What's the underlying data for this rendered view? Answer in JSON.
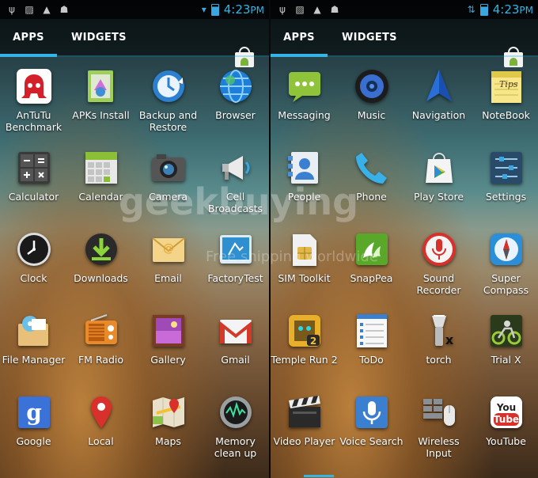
{
  "status": {
    "time": "4:23",
    "ampm": "PM"
  },
  "tabs": {
    "apps": "APPS",
    "widgets": "WIDGETS"
  },
  "watermark": {
    "main": "geekbuying",
    "sub": "Free shipping worldwide"
  },
  "colors": {
    "accent": "#33b5e5"
  },
  "left_apps": [
    {
      "label": "AnTuTu Benchmark",
      "icon": "antutu-icon"
    },
    {
      "label": "APKs Install",
      "icon": "apk-install-icon"
    },
    {
      "label": "Backup and Restore",
      "icon": "backup-restore-icon"
    },
    {
      "label": "Browser",
      "icon": "browser-globe-icon"
    },
    {
      "label": "Calculator",
      "icon": "calculator-icon"
    },
    {
      "label": "Calendar",
      "icon": "calendar-icon"
    },
    {
      "label": "Camera",
      "icon": "camera-icon"
    },
    {
      "label": "Cell Broadcasts",
      "icon": "megaphone-icon"
    },
    {
      "label": "Clock",
      "icon": "clock-icon"
    },
    {
      "label": "Downloads",
      "icon": "download-icon"
    },
    {
      "label": "Email",
      "icon": "email-icon"
    },
    {
      "label": "FactoryTest",
      "icon": "factory-test-icon"
    },
    {
      "label": "File Manager",
      "icon": "file-manager-icon"
    },
    {
      "label": "FM Radio",
      "icon": "radio-icon"
    },
    {
      "label": "Gallery",
      "icon": "gallery-icon"
    },
    {
      "label": "Gmail",
      "icon": "gmail-icon"
    },
    {
      "label": "Google",
      "icon": "google-icon"
    },
    {
      "label": "Local",
      "icon": "map-pin-icon"
    },
    {
      "label": "Maps",
      "icon": "maps-icon"
    },
    {
      "label": "Memory clean up",
      "icon": "memory-clean-icon"
    }
  ],
  "right_apps": [
    {
      "label": "Messaging",
      "icon": "messaging-icon"
    },
    {
      "label": "Music",
      "icon": "music-speaker-icon"
    },
    {
      "label": "Navigation",
      "icon": "navigation-arrow-icon"
    },
    {
      "label": "NoteBook",
      "icon": "notebook-icon"
    },
    {
      "label": "People",
      "icon": "people-contact-icon"
    },
    {
      "label": "Phone",
      "icon": "phone-icon"
    },
    {
      "label": "Play Store",
      "icon": "play-store-icon"
    },
    {
      "label": "Settings",
      "icon": "settings-sliders-icon"
    },
    {
      "label": "SIM Toolkit",
      "icon": "sim-card-icon"
    },
    {
      "label": "SnapPea",
      "icon": "snappea-icon"
    },
    {
      "label": "Sound Recorder",
      "icon": "microphone-record-icon"
    },
    {
      "label": "Super Compass",
      "icon": "compass-icon"
    },
    {
      "label": "Temple Run 2",
      "icon": "temple-run-icon"
    },
    {
      "label": "ToDo",
      "icon": "todo-list-icon"
    },
    {
      "label": "torch",
      "icon": "flashlight-icon"
    },
    {
      "label": "Trial X",
      "icon": "motorbike-icon"
    },
    {
      "label": "Video Player",
      "icon": "clapperboard-icon"
    },
    {
      "label": "Voice Search",
      "icon": "voice-mic-icon"
    },
    {
      "label": "Wireless Input",
      "icon": "wireless-mouse-icon"
    },
    {
      "label": "YouTube",
      "icon": "youtube-icon"
    }
  ]
}
